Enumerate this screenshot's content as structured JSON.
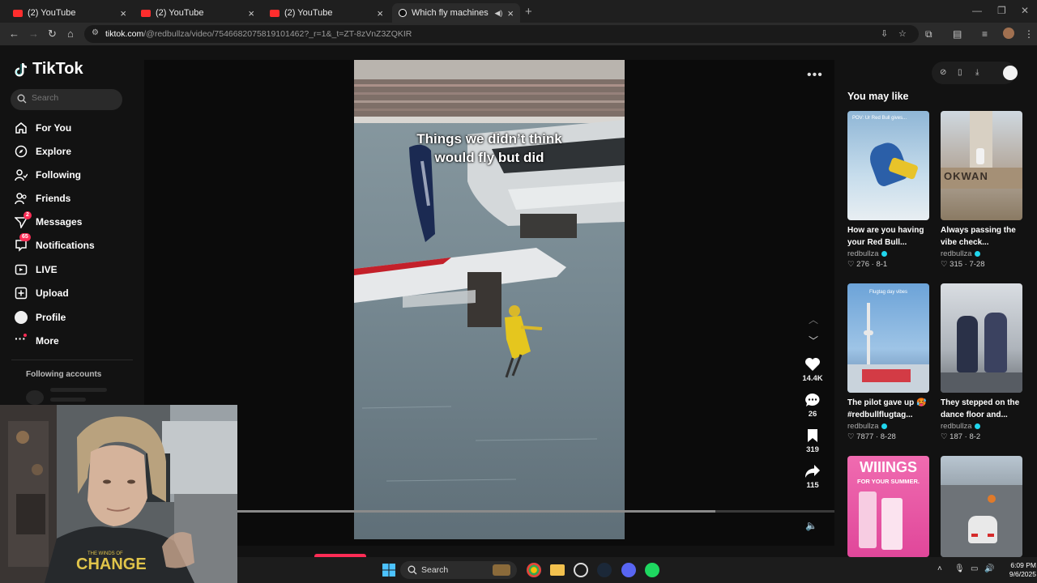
{
  "browser": {
    "tabs": [
      {
        "title": "(2) YouTube",
        "active": false
      },
      {
        "title": "(2) YouTube",
        "active": false
      },
      {
        "title": "(2) YouTube",
        "active": false
      },
      {
        "title": "Which fly machines do you",
        "active": true
      }
    ],
    "url_host": "tiktok.com",
    "url_rest": "/@redbullza/video/7546682075819101462?_r=1&_t=ZT-8zVnZ3ZQKIR"
  },
  "sidebar": {
    "logo": "TikTok",
    "search_placeholder": "Search",
    "nav": [
      {
        "label": "For You",
        "icon": "home-icon"
      },
      {
        "label": "Explore",
        "icon": "compass-icon"
      },
      {
        "label": "Following",
        "icon": "following-icon"
      },
      {
        "label": "Friends",
        "icon": "friends-icon"
      },
      {
        "label": "Messages",
        "icon": "messages-icon",
        "badge": "2"
      },
      {
        "label": "Notifications",
        "icon": "notifications-icon",
        "badge": "65"
      },
      {
        "label": "LIVE",
        "icon": "live-icon"
      },
      {
        "label": "Upload",
        "icon": "upload-icon"
      },
      {
        "label": "Profile",
        "icon": "profile-icon"
      },
      {
        "label": "More",
        "icon": "more-icon"
      }
    ],
    "following_accounts": "Following accounts"
  },
  "video": {
    "caption_line1": "Things we didn’t think",
    "caption_line2": "would fly but did",
    "progress": 0.8,
    "likes": "14.4K",
    "comments": "26",
    "saves": "319",
    "shares": "115"
  },
  "recommendations": {
    "title": "You may like",
    "cards": [
      {
        "title": "How are you having your Red Bull...",
        "author": "redbullza",
        "likes": "276",
        "date": "8-1"
      },
      {
        "title": "Always passing the vibe check...",
        "author": "redbullza",
        "likes": "315",
        "date": "7-28"
      },
      {
        "title": "The pilot gave up 🥵 #redbullflugtag...",
        "author": "redbullza",
        "likes": "7877",
        "date": "8-28"
      },
      {
        "title": "They stepped on the dance floor and...",
        "author": "redbullza",
        "likes": "187",
        "date": "8-2"
      },
      {
        "title": "",
        "author": "",
        "likes": "",
        "date": ""
      },
      {
        "title": "",
        "author": "",
        "likes": "",
        "date": ""
      }
    ],
    "thumb_texts": {
      "card1": "POV: Ur Red Bull gives...",
      "card2": "OKWAN",
      "card3": "Flugtag day vibes",
      "card5_big": "WIIINGS",
      "card5_small": "FOR YOUR SUMMER."
    }
  },
  "webcam": {
    "shirt_text": "CHANGE",
    "shirt_small": "THE WINDS OF"
  },
  "taskbar": {
    "search": "Search",
    "time": "6:09 PM",
    "date": "9/6/2025"
  }
}
